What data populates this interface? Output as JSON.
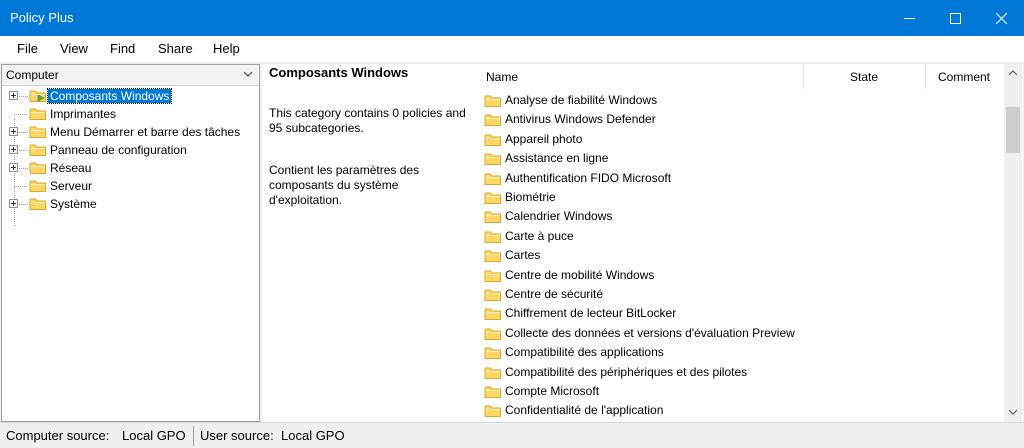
{
  "window": {
    "title": "Policy Plus"
  },
  "menu": [
    "File",
    "View",
    "Find",
    "Share",
    "Help"
  ],
  "scope_combo": {
    "value": "Computer"
  },
  "tree": [
    {
      "label": "Composants Windows",
      "selected": true,
      "expandable": true
    },
    {
      "label": "Imprimantes",
      "selected": false,
      "expandable": false
    },
    {
      "label": "Menu Démarrer et barre des tâches",
      "selected": false,
      "expandable": true
    },
    {
      "label": "Panneau de configuration",
      "selected": false,
      "expandable": true
    },
    {
      "label": "Réseau",
      "selected": false,
      "expandable": true
    },
    {
      "label": "Serveur",
      "selected": false,
      "expandable": false
    },
    {
      "label": "Système",
      "selected": false,
      "expandable": true
    }
  ],
  "description": {
    "title": "Composants Windows",
    "summary": "This category contains 0 policies and 95 subcategories.",
    "detail": "Contient les paramètres des composants du système d'exploitation."
  },
  "list": {
    "columns": {
      "name": "Name",
      "state": "State",
      "comment": "Comment"
    },
    "rows": [
      "Analyse de fiabilité Windows",
      "Antivirus Windows Defender",
      "Appareil photo",
      "Assistance en ligne",
      "Authentification FIDO Microsoft",
      "Biométrie",
      "Calendrier Windows",
      "Carte à puce",
      "Cartes",
      "Centre de mobilité Windows",
      "Centre de sécurité",
      "Chiffrement de lecteur BitLocker",
      "Collecte des données et versions d'évaluation Preview",
      "Compatibilité des applications",
      "Compatibilité des périphériques et des pilotes",
      "Compte Microsoft",
      "Confidentialité de l'application"
    ]
  },
  "status": {
    "computer_label": "Computer source:",
    "computer_value": "Local GPO",
    "user_label": "User source:",
    "user_value": "Local GPO"
  },
  "colors": {
    "titlebar": "#0078d7",
    "folder": "#ffd766",
    "folder_dark": "#d9a825",
    "selection": "#0078d7"
  }
}
